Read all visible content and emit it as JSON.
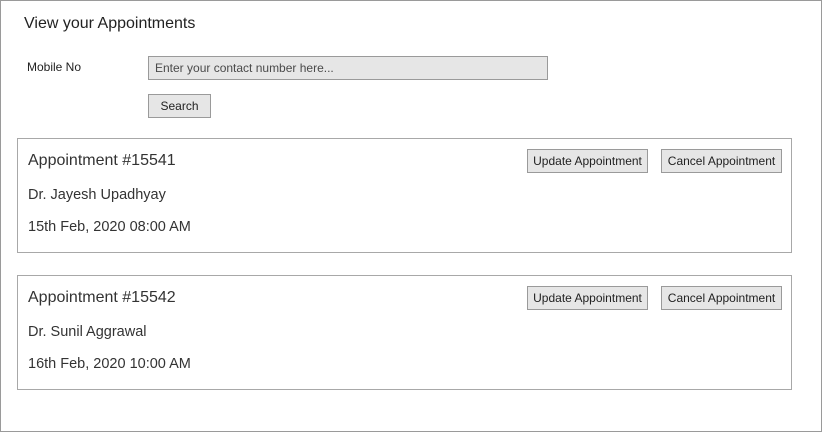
{
  "page": {
    "title": "View your Appointments"
  },
  "search": {
    "label": "Mobile No",
    "placeholder": "Enter your contact number here...",
    "value": "",
    "button_label": "Search"
  },
  "appointments": [
    {
      "title": "Appointment #15541",
      "doctor": "Dr. Jayesh Upadhyay",
      "datetime": "15th Feb, 2020 08:00 AM",
      "update_label": "Update Appointment",
      "cancel_label": "Cancel Appointment"
    },
    {
      "title": "Appointment #15542",
      "doctor": "Dr. Sunil Aggrawal",
      "datetime": "16th Feb, 2020 10:00 AM",
      "update_label": "Update Appointment",
      "cancel_label": "Cancel Appointment"
    }
  ]
}
